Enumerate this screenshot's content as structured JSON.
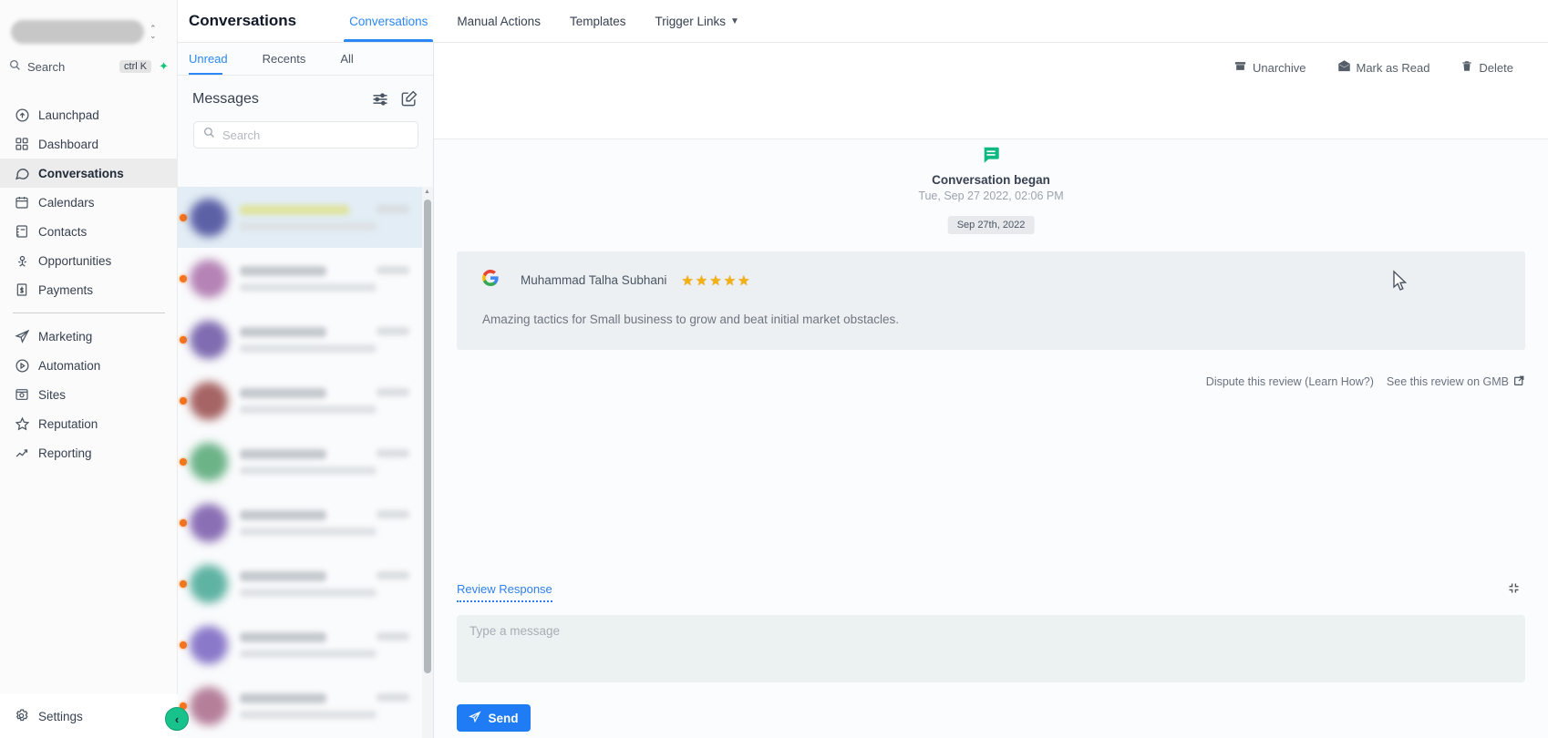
{
  "header": {
    "page_title": "Conversations",
    "tabs": [
      {
        "label": "Conversations",
        "active": true
      },
      {
        "label": "Manual Actions",
        "active": false
      },
      {
        "label": "Templates",
        "active": false
      },
      {
        "label": "Trigger Links",
        "active": false,
        "dropdown": true
      }
    ]
  },
  "sidebar": {
    "search_label": "Search",
    "search_shortcut": "ctrl K",
    "items": [
      {
        "label": "Launchpad",
        "icon": "launchpad-icon",
        "active": false
      },
      {
        "label": "Dashboard",
        "icon": "dashboard-icon",
        "active": false
      },
      {
        "label": "Conversations",
        "icon": "conversations-icon",
        "active": true
      },
      {
        "label": "Calendars",
        "icon": "calendars-icon",
        "active": false
      },
      {
        "label": "Contacts",
        "icon": "contacts-icon",
        "active": false
      },
      {
        "label": "Opportunities",
        "icon": "opportunities-icon",
        "active": false
      },
      {
        "label": "Payments",
        "icon": "payments-icon",
        "active": false
      },
      {
        "label": "Marketing",
        "icon": "marketing-icon",
        "active": false
      },
      {
        "label": "Automation",
        "icon": "automation-icon",
        "active": false
      },
      {
        "label": "Sites",
        "icon": "sites-icon",
        "active": false
      },
      {
        "label": "Reputation",
        "icon": "reputation-icon",
        "active": false
      },
      {
        "label": "Reporting",
        "icon": "reporting-icon",
        "active": false
      }
    ],
    "settings_label": "Settings"
  },
  "messages_panel": {
    "tabs": [
      {
        "label": "Unread",
        "active": true
      },
      {
        "label": "Recents",
        "active": false
      },
      {
        "label": "All",
        "active": false
      }
    ],
    "title": "Messages",
    "search_placeholder": "Search",
    "conversation_items": [
      {
        "avatar_color": "#5c61a6",
        "unread": true,
        "selected": true,
        "highlight": true
      },
      {
        "avatar_color": "#b583b5",
        "unread": true,
        "selected": false,
        "highlight": false
      },
      {
        "avatar_color": "#7f6cb1",
        "unread": true,
        "selected": false,
        "highlight": false
      },
      {
        "avatar_color": "#a66464",
        "unread": true,
        "selected": false,
        "highlight": false
      },
      {
        "avatar_color": "#6cb388",
        "unread": true,
        "selected": false,
        "highlight": false
      },
      {
        "avatar_color": "#8a6fb5",
        "unread": true,
        "selected": false,
        "highlight": false
      },
      {
        "avatar_color": "#5fb3a3",
        "unread": true,
        "selected": false,
        "highlight": false
      },
      {
        "avatar_color": "#8a79c9",
        "unread": true,
        "selected": false,
        "highlight": false
      },
      {
        "avatar_color": "#b57f9a",
        "unread": true,
        "selected": false,
        "highlight": false
      }
    ]
  },
  "toolbar": {
    "unarchive_label": "Unarchive",
    "mark_read_label": "Mark as Read",
    "delete_label": "Delete"
  },
  "conversation": {
    "began_title": "Conversation began",
    "began_time": "Tue, Sep 27 2022, 02:06 PM",
    "date_separator": "Sep 27th, 2022",
    "review": {
      "source": "Google",
      "author": "Muhammad Talha Subhani",
      "rating": 5,
      "stars": "★★★★★",
      "text": "Amazing tactics for Small business to grow and beat initial market obstacles."
    },
    "dispute_link": "Dispute this review (Learn How?)",
    "gmb_link": "See this review on GMB"
  },
  "composer": {
    "tab_label": "Review Response",
    "placeholder": "Type a message",
    "send_label": "Send"
  },
  "colors": {
    "accent_blue": "#2b87f5",
    "send_blue": "#1f7cf4",
    "began_green": "#10b981",
    "collapse_green": "#17c28b",
    "unread_orange": "#f97316",
    "star_gold": "#f3b10a"
  }
}
